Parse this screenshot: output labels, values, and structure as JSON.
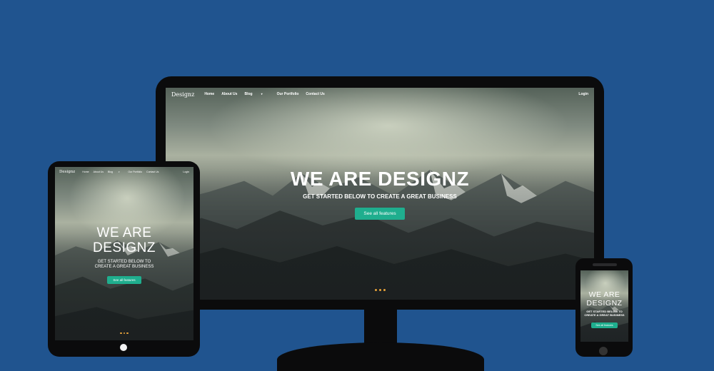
{
  "colors": {
    "background": "#20548f",
    "device": "#0b0b0c",
    "accent": "#1fae8e",
    "dot": "#e8a33a"
  },
  "site": {
    "logo": "Designz",
    "nav": [
      {
        "label": "Home"
      },
      {
        "label": "About Us"
      },
      {
        "label": "Blog"
      },
      {
        "label": "Our Portfolio"
      },
      {
        "label": "Contact Us"
      }
    ],
    "login": "Login",
    "hero_title": "WE ARE DESIGNZ",
    "hero_title_line1": "WE ARE",
    "hero_title_line2": "DESIGNZ",
    "hero_subtitle": "GET STARTED BELOW TO CREATE A GREAT BUSINESS",
    "hero_subtitle_line1": "GET STARTED BELOW TO",
    "hero_subtitle_line2": "CREATE A GREAT BUSINESS",
    "cta": "See all features"
  },
  "icons": [
    "chevron-down-icon",
    "slider-dot-icon",
    "home-button-icon"
  ]
}
